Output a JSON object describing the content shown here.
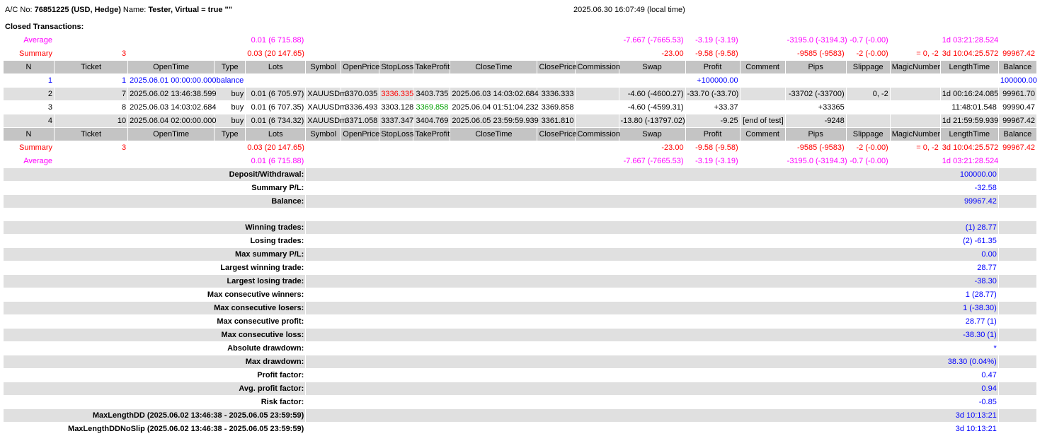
{
  "header": {
    "account_label": "A/C No:",
    "account": "76851225 (USD, Hedge)",
    "name_label": "Name:",
    "name": "Tester, Virtual = true \"\"",
    "timestamp": "2025.06.30 16:07:49 (local time)"
  },
  "section_title": "Closed Transactions:",
  "colors": {
    "average": "#ff00ff",
    "summary": "#ff0000",
    "balance_row": "#0000ff",
    "stop_loss_hit": "#ff0000",
    "take_profit_hit": "#00a000",
    "header_bg": "#c4c4c4",
    "row_bg": "#e0e0e0"
  },
  "columns": [
    "N",
    "Ticket",
    "OpenTime",
    "Type",
    "Lots",
    "Symbol",
    "OpenPrice",
    "StopLoss",
    "TakeProfit",
    "CloseTime",
    "ClosePrice",
    "Commission",
    "Swap",
    "Profit",
    "Comment",
    "Pips",
    "Slippage",
    "MagicNumber",
    "LengthTime",
    "Balance"
  ],
  "average": [
    "Average",
    "",
    "",
    "",
    "0.01 (6 715.88)",
    "",
    "",
    "",
    "",
    "",
    "",
    "",
    "-7.667 (-7665.53)",
    "-3.19 (-3.19)",
    "",
    "-3195.0 (-3194.3)",
    "-0.7 (-0.00)",
    "",
    "1d 03:21:28.524",
    ""
  ],
  "summary": [
    "Summary",
    "3",
    "",
    "",
    "0.03 (20 147.65)",
    "",
    "",
    "",
    "",
    "",
    "",
    "",
    "-23.00",
    "-9.58 (-9.58)",
    "",
    "-9585 (-9583)",
    "-2 (-0.00)",
    "= 0, -2",
    "3d 10:04:25.572",
    "99967.42"
  ],
  "rows": [
    [
      "1",
      "1",
      "2025.06.01 00:00:00.000",
      "balance",
      "",
      "",
      "",
      "",
      "",
      "",
      "",
      "",
      "",
      "+100000.00",
      "",
      "",
      "",
      "",
      "",
      "100000.00"
    ],
    [
      "2",
      "7",
      "2025.06.02 13:46:38.599",
      "buy",
      "0.01 (6 705.97)",
      "XAUUSDm",
      "3370.035",
      "3336.335",
      "3403.735",
      "2025.06.03 14:03:02.684",
      "3336.333",
      "",
      "-4.60 (-4600.27)",
      "-33.70 (-33.70)",
      "",
      "-33702 (-33700)",
      "0, -2",
      "",
      "1d 00:16:24.085",
      "99961.70"
    ],
    [
      "3",
      "8",
      "2025.06.03 14:03:02.684",
      "buy",
      "0.01 (6 707.35)",
      "XAUUSDm",
      "3336.493",
      "3303.128",
      "3369.858",
      "2025.06.04 01:51:04.232",
      "3369.858",
      "",
      "-4.60 (-4599.31)",
      "+33.37",
      "",
      "+33365",
      "",
      "",
      "11:48:01.548",
      "99990.47"
    ],
    [
      "4",
      "10",
      "2025.06.04 02:00:00.000",
      "buy",
      "0.01 (6 734.32)",
      "XAUUSDm",
      "3371.058",
      "3337.347",
      "3404.769",
      "2025.06.05 23:59:59.939",
      "3361.810",
      "",
      "-13.80 (-13797.02)",
      "-9.25",
      "[end of test]",
      "-9248",
      "",
      "",
      "1d 21:59:59.939",
      "99967.42"
    ]
  ],
  "stats": [
    {
      "label": "Deposit/Withdrawal:",
      "value": "100000.00"
    },
    {
      "label": "Summary P/L:",
      "value": "-32.58"
    },
    {
      "label": "Balance:",
      "value": "99967.42"
    },
    {
      "label": "",
      "value": ""
    },
    {
      "label": "Winning trades:",
      "value": "(1) 28.77"
    },
    {
      "label": "Losing trades:",
      "value": "(2) -61.35"
    },
    {
      "label": "Max summary P/L:",
      "value": "0.00"
    },
    {
      "label": "Largest winning trade:",
      "value": "28.77"
    },
    {
      "label": "Largest losing trade:",
      "value": "-38.30"
    },
    {
      "label": "Max consecutive winners:",
      "value": "1 (28.77)"
    },
    {
      "label": "Max consecutive losers:",
      "value": "1 (-38.30)"
    },
    {
      "label": "Max consecutive profit:",
      "value": "28.77 (1)"
    },
    {
      "label": "Max consecutive loss:",
      "value": "-38.30 (1)"
    },
    {
      "label": "Absolute drawdown:",
      "value": "*"
    },
    {
      "label": "Max drawdown:",
      "value": "38.30 (0.04%)"
    },
    {
      "label": "Profit factor:",
      "value": "0.47"
    },
    {
      "label": "Avg. profit factor:",
      "value": "0.94"
    },
    {
      "label": "Risk factor:",
      "value": "-0.85"
    },
    {
      "label": "MaxLengthDD (2025.06.02 13:46:38 - 2025.06.05 23:59:59)",
      "value": "3d 10:13:21"
    },
    {
      "label": "MaxLengthDDNoSlip (2025.06.02 13:46:38 - 2025.06.05 23:59:59)",
      "value": "3d 10:13:21"
    }
  ]
}
